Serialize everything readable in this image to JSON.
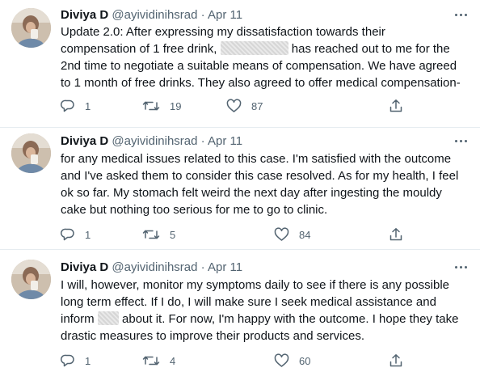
{
  "tweets": [
    {
      "name": "Diviya D",
      "handle": "@ayividinihsrad",
      "separator": "·",
      "date": "Apr 11",
      "lines": [
        [
          "Update 2.0: After expressing my dissatisfaction towards their"
        ],
        [
          "compensation of 1 free drink, ",
          "",
          " has reached out to me for the"
        ],
        [
          "2nd time to negotiate a suitable means of compensation. We have agreed"
        ],
        [
          "to 1 month of free drinks. They also agreed to offer medical compensation-"
        ]
      ],
      "replies": "1",
      "retweets": "19",
      "likes": "87"
    },
    {
      "name": "Diviya D",
      "handle": "@ayividinihsrad",
      "separator": "·",
      "date": "Apr 11",
      "lines": [
        [
          "for any medical issues related to this case. I'm satisfied with the outcome"
        ],
        [
          "and I've asked them to consider this case resolved. As for my health, I feel"
        ],
        [
          "ok so far. My stomach felt weird the next day after ingesting the mouldy"
        ],
        [
          "cake but nothing too serious for me to go to clinic."
        ]
      ],
      "replies": "1",
      "retweets": "5",
      "likes": "84"
    },
    {
      "name": "Diviya D",
      "handle": "@ayividinihsrad",
      "separator": "·",
      "date": "Apr 11",
      "lines": [
        [
          "I will, however, monitor my symptoms daily to see if there is any possible"
        ],
        [
          "long term effect. If I do, I will make sure I seek medical assistance and"
        ],
        [
          "inform ",
          "",
          " about it. For now, I'm happy with the outcome. I hope they take"
        ],
        [
          "drastic measures to improve their products and services."
        ]
      ],
      "replies": "1",
      "retweets": "4",
      "likes": "60"
    }
  ],
  "icons": {
    "reply": "reply-icon",
    "retweet": "retweet-icon",
    "like": "heart-icon",
    "share": "share-icon",
    "more": "more-icon"
  },
  "colors": {
    "text": "#0f1419",
    "secondary": "#536471",
    "divider": "#e6ecf0"
  }
}
